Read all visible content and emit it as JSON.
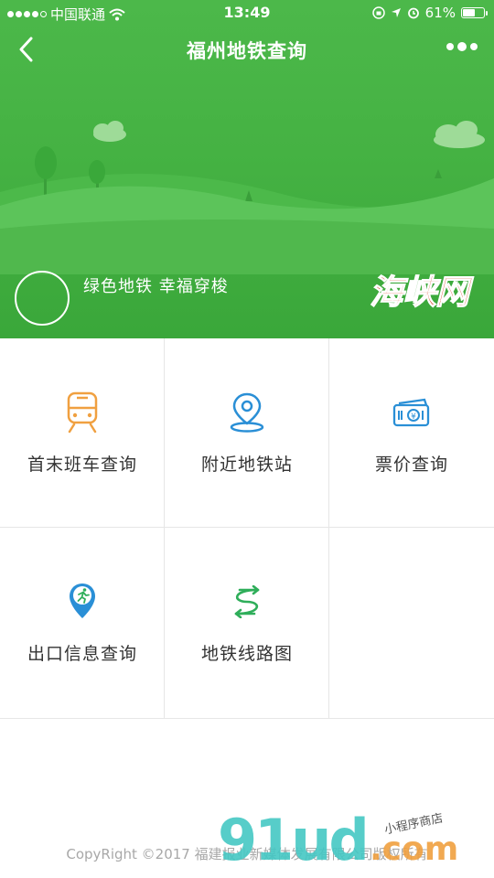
{
  "status_bar": {
    "carrier": "中国联通",
    "time": "13:49",
    "battery_percent": "61%",
    "battery_level": 0.61
  },
  "navbar": {
    "title": "福州地铁查询",
    "back_icon": "chevron-left-icon",
    "more_icon": "more-dots-icon"
  },
  "hero": {
    "slogan": "绿色地铁 幸福穿梭",
    "logo_text": "海峡网",
    "colors": {
      "green": "#45b243",
      "hill": "#5cc45a",
      "logo_red": "#d43a1a"
    }
  },
  "menu": [
    {
      "label": "首末班车查询",
      "icon": "train-icon",
      "color": "#f0a040"
    },
    {
      "label": "附近地铁站",
      "icon": "location-pin-icon",
      "color": "#2a8fd6"
    },
    {
      "label": "票价查询",
      "icon": "ticket-icon",
      "color": "#2a8fd6"
    },
    {
      "label": "出口信息查询",
      "icon": "exit-runner-icon",
      "color": "#2a8fd6"
    },
    {
      "label": "地铁线路图",
      "icon": "route-switch-icon",
      "color": "#2fae5a"
    },
    {
      "label": "",
      "icon": "",
      "color": ""
    }
  ],
  "footer": {
    "copyright": "CopyRight ©2017 福建报业新媒体发展有限公司版权所有",
    "watermark_text": "91ud.com",
    "watermark_sub": "小程序商店"
  }
}
